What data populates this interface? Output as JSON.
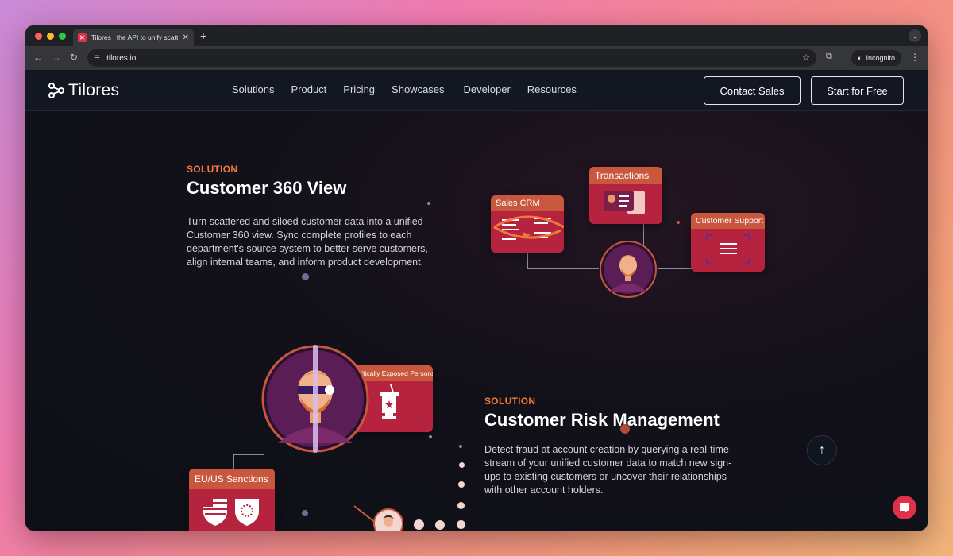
{
  "browser": {
    "tab_title": "Tilores | the API to unify scattered customer data",
    "new_tab": "+",
    "url": "tilores.io",
    "incognito_label": "Incognito"
  },
  "site": {
    "logo_text": "Tilores",
    "nav": [
      "Solutions",
      "Product",
      "Pricing",
      "Showcases",
      "Developer",
      "Resources"
    ],
    "contact_sales": "Contact Sales",
    "start_free": "Start for Free"
  },
  "section1": {
    "eyebrow": "SOLUTION",
    "title": "Customer 360 View",
    "body": "Turn scattered and siloed customer data into a unified Customer 360 view. Sync complete profiles to each department's source system to better serve customers, align internal teams, and inform product development.",
    "cards": {
      "sales_crm": "Sales CRM",
      "transactions": "Transactions",
      "customer_support": "Customer Support"
    }
  },
  "section2": {
    "eyebrow": "SOLUTION",
    "title": "Customer Risk Management",
    "body": "Detect fraud at account creation by querying a real-time stream of your unified customer data to match new sign-ups to existing customers or uncover their relationships with other account holders.",
    "cards": {
      "pep": "Politically Exposed Persons",
      "sanctions": "EU/US Sanctions"
    }
  },
  "colors": {
    "accent": "#f07a3c",
    "card_body": "#b6233e",
    "card_header": "#c8573e",
    "chat": "#e0304a"
  }
}
